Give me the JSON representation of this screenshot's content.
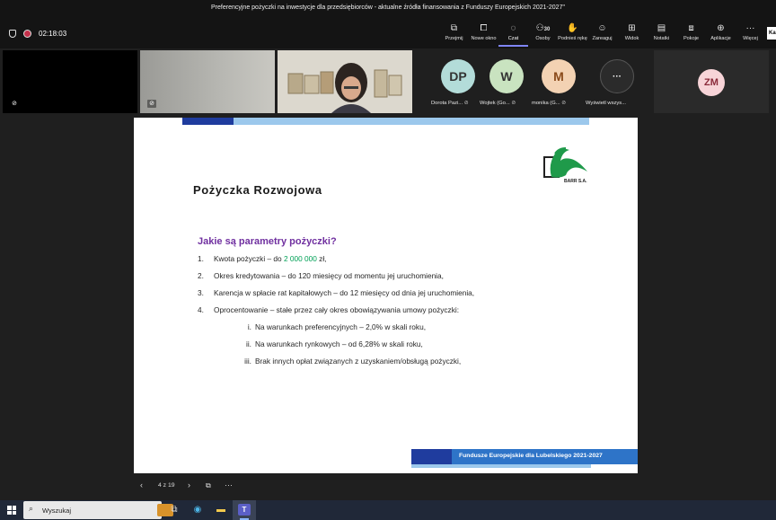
{
  "window": {
    "title": "Preferencyjne pożyczki na inwestycje dla przedsiębiorców - aktualne źródła finansowania z Funduszy Europejskich 2021-2027\""
  },
  "meeting": {
    "timer": "02:18:03"
  },
  "toolbar": {
    "tools": [
      {
        "label": "Przejmij",
        "icon": "present-icon"
      },
      {
        "label": "Nowe okno",
        "icon": "new-window-icon"
      },
      {
        "label": "Czat",
        "icon": "chat-icon",
        "active": true
      },
      {
        "label": "Osoby",
        "icon": "people-icon",
        "count": "30"
      },
      {
        "label": "Podnieś rękę",
        "icon": "raise-hand-icon"
      },
      {
        "label": "Zareaguj",
        "icon": "react-icon"
      },
      {
        "label": "Widok",
        "icon": "view-icon"
      },
      {
        "label": "Notatki",
        "icon": "notes-icon"
      },
      {
        "label": "Pokoje",
        "icon": "rooms-icon"
      },
      {
        "label": "Aplikacje",
        "icon": "apps-icon"
      },
      {
        "label": "Więcej",
        "icon": "more-icon"
      }
    ],
    "leave_label": "Ka"
  },
  "participants": [
    {
      "initials": "DP",
      "name": "Dorota Pazi...",
      "color": "#b3dcd9"
    },
    {
      "initials": "W",
      "name": "Wojtek (Go...",
      "color": "#c9e3c0"
    },
    {
      "initials": "M",
      "name": "monika (G...",
      "color": "#f3d2b3"
    },
    {
      "initials": "···",
      "name": "Wyświetl wszys...",
      "color": "#2b2b2b"
    }
  ],
  "extra_participant": {
    "initials": "ZM",
    "color": "#f7d4d8"
  },
  "slide": {
    "logo_text": "BARR S.A.",
    "title": "Pożyczka Rozwojowa",
    "question": "Jakie są parametry pożyczki?",
    "items": [
      {
        "num": "1.",
        "pre": "Kwota pożyczki – do ",
        "highlight": "2 000 000",
        "post": " zł,"
      },
      {
        "num": "2.",
        "pre": "Okres kredytowania – do 120 miesięcy od momentu jej uruchomienia,",
        "highlight": "",
        "post": ""
      },
      {
        "num": "3.",
        "pre": "Karencja w spłacie rat kapitałowych – do 12 miesięcy od dnia jej uruchomienia,",
        "highlight": "",
        "post": ""
      },
      {
        "num": "4.",
        "pre": "Oprocentowanie – stałe przez cały okres obowiązywania umowy pożyczki:",
        "highlight": "",
        "post": ""
      }
    ],
    "subitems": [
      {
        "num": "i.",
        "text": "Na warunkach preferencyjnych – 2,0% w skali roku,"
      },
      {
        "num": "ii.",
        "text": "Na warunkach rynkowych – od 6,28% w skali roku,"
      },
      {
        "num": "iii.",
        "text": "Brak innych opłat związanych z uzyskaniem/obsługą pożyczki,"
      }
    ],
    "footer": "Fundusze Europejskie dla Lubelskiego 2021-2027"
  },
  "slide_nav": {
    "counter": "4 z 19"
  },
  "taskbar": {
    "search_placeholder": "Wyszukaj"
  }
}
